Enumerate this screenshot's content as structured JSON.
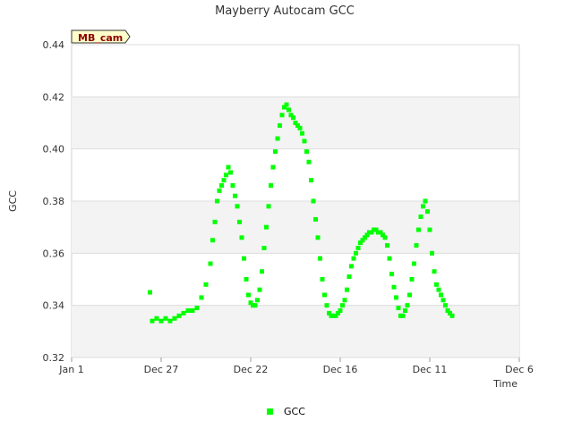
{
  "chart_data": {
    "type": "scatter",
    "title": "Mayberry Autocam GCC",
    "xlabel": "Time",
    "ylabel": "GCC",
    "site_label": "MB_cam",
    "x_tick_labels": [
      "Jan 1",
      "Dec 27",
      "Dec 22",
      "Dec 16",
      "Dec 11",
      "Dec 6"
    ],
    "ylim": [
      0.32,
      0.44
    ],
    "y_ticks": [
      0.32,
      0.34,
      0.36,
      0.38,
      0.4,
      0.42,
      0.44
    ],
    "y_tick_labels": [
      "0.32",
      "0.34",
      "0.36",
      "0.38",
      "0.40",
      "0.42",
      "0.44"
    ],
    "grid": true,
    "legend_position": "bottom",
    "series": [
      {
        "name": "GCC",
        "color": "#00ff00",
        "marker": "square",
        "points": [
          [
            0.175,
            0.345
          ],
          [
            0.18,
            0.334
          ],
          [
            0.19,
            0.335
          ],
          [
            0.2,
            0.334
          ],
          [
            0.21,
            0.335
          ],
          [
            0.22,
            0.334
          ],
          [
            0.23,
            0.335
          ],
          [
            0.24,
            0.336
          ],
          [
            0.25,
            0.337
          ],
          [
            0.26,
            0.338
          ],
          [
            0.27,
            0.338
          ],
          [
            0.28,
            0.339
          ],
          [
            0.29,
            0.343
          ],
          [
            0.3,
            0.348
          ],
          [
            0.31,
            0.356
          ],
          [
            0.315,
            0.365
          ],
          [
            0.32,
            0.372
          ],
          [
            0.325,
            0.38
          ],
          [
            0.33,
            0.384
          ],
          [
            0.335,
            0.386
          ],
          [
            0.34,
            0.388
          ],
          [
            0.345,
            0.39
          ],
          [
            0.35,
            0.393
          ],
          [
            0.355,
            0.391
          ],
          [
            0.36,
            0.386
          ],
          [
            0.365,
            0.382
          ],
          [
            0.37,
            0.378
          ],
          [
            0.375,
            0.372
          ],
          [
            0.38,
            0.366
          ],
          [
            0.385,
            0.358
          ],
          [
            0.39,
            0.35
          ],
          [
            0.395,
            0.344
          ],
          [
            0.4,
            0.341
          ],
          [
            0.405,
            0.34
          ],
          [
            0.41,
            0.34
          ],
          [
            0.415,
            0.342
          ],
          [
            0.42,
            0.346
          ],
          [
            0.425,
            0.353
          ],
          [
            0.43,
            0.362
          ],
          [
            0.435,
            0.37
          ],
          [
            0.44,
            0.378
          ],
          [
            0.445,
            0.386
          ],
          [
            0.45,
            0.393
          ],
          [
            0.455,
            0.399
          ],
          [
            0.46,
            0.404
          ],
          [
            0.465,
            0.409
          ],
          [
            0.47,
            0.413
          ],
          [
            0.475,
            0.416
          ],
          [
            0.48,
            0.417
          ],
          [
            0.485,
            0.415
          ],
          [
            0.49,
            0.413
          ],
          [
            0.495,
            0.412
          ],
          [
            0.5,
            0.41
          ],
          [
            0.505,
            0.409
          ],
          [
            0.51,
            0.408
          ],
          [
            0.515,
            0.406
          ],
          [
            0.52,
            0.403
          ],
          [
            0.525,
            0.399
          ],
          [
            0.53,
            0.395
          ],
          [
            0.535,
            0.388
          ],
          [
            0.54,
            0.38
          ],
          [
            0.545,
            0.373
          ],
          [
            0.55,
            0.366
          ],
          [
            0.555,
            0.358
          ],
          [
            0.56,
            0.35
          ],
          [
            0.565,
            0.344
          ],
          [
            0.57,
            0.34
          ],
          [
            0.575,
            0.337
          ],
          [
            0.58,
            0.336
          ],
          [
            0.585,
            0.336
          ],
          [
            0.59,
            0.336
          ],
          [
            0.595,
            0.337
          ],
          [
            0.6,
            0.338
          ],
          [
            0.605,
            0.34
          ],
          [
            0.61,
            0.342
          ],
          [
            0.615,
            0.346
          ],
          [
            0.62,
            0.351
          ],
          [
            0.625,
            0.355
          ],
          [
            0.63,
            0.358
          ],
          [
            0.635,
            0.36
          ],
          [
            0.64,
            0.362
          ],
          [
            0.645,
            0.364
          ],
          [
            0.65,
            0.365
          ],
          [
            0.655,
            0.366
          ],
          [
            0.66,
            0.367
          ],
          [
            0.665,
            0.368
          ],
          [
            0.67,
            0.368
          ],
          [
            0.675,
            0.369
          ],
          [
            0.68,
            0.369
          ],
          [
            0.685,
            0.368
          ],
          [
            0.69,
            0.368
          ],
          [
            0.695,
            0.367
          ],
          [
            0.7,
            0.366
          ],
          [
            0.705,
            0.363
          ],
          [
            0.71,
            0.358
          ],
          [
            0.715,
            0.352
          ],
          [
            0.72,
            0.347
          ],
          [
            0.725,
            0.343
          ],
          [
            0.73,
            0.339
          ],
          [
            0.735,
            0.336
          ],
          [
            0.74,
            0.336
          ],
          [
            0.745,
            0.338
          ],
          [
            0.75,
            0.34
          ],
          [
            0.755,
            0.344
          ],
          [
            0.76,
            0.35
          ],
          [
            0.765,
            0.356
          ],
          [
            0.77,
            0.363
          ],
          [
            0.775,
            0.369
          ],
          [
            0.78,
            0.374
          ],
          [
            0.785,
            0.378
          ],
          [
            0.79,
            0.38
          ],
          [
            0.795,
            0.376
          ],
          [
            0.8,
            0.369
          ],
          [
            0.805,
            0.36
          ],
          [
            0.81,
            0.353
          ],
          [
            0.815,
            0.348
          ],
          [
            0.82,
            0.346
          ],
          [
            0.825,
            0.344
          ],
          [
            0.83,
            0.342
          ],
          [
            0.835,
            0.34
          ],
          [
            0.84,
            0.338
          ],
          [
            0.845,
            0.337
          ],
          [
            0.85,
            0.336
          ]
        ]
      }
    ]
  }
}
